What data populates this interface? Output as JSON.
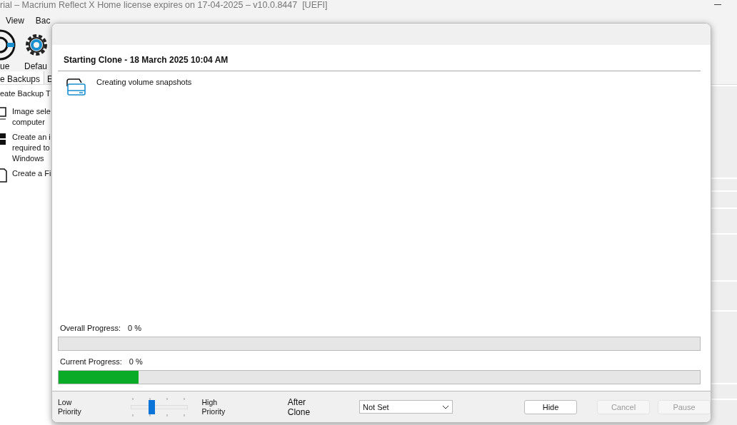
{
  "window": {
    "title": "rial – Macrium Reflect X Home license expires on 17-04-2025 – v10.0.8447  [UEFI]"
  },
  "menu": [
    "View",
    "Bac"
  ],
  "toolbar": [
    {
      "kind": "lifebuoy",
      "label": "ue"
    },
    {
      "kind": "gear",
      "label": "Defau"
    }
  ],
  "tabs": [
    {
      "label": "e Backups",
      "selected": true
    },
    {
      "label": "E",
      "selected": false
    }
  ],
  "tasks": {
    "heading": "eate Backup T",
    "items": [
      {
        "kind": "monitor",
        "lines": [
          "Image sele",
          "computer"
        ]
      },
      {
        "kind": "windows",
        "lines": [
          "Create an i",
          "required to",
          "Windows"
        ]
      },
      {
        "kind": "file",
        "lines": [
          "Create a Fi"
        ]
      }
    ]
  },
  "dialog": {
    "title": "Starting Clone - 18 March 2025 10:04 AM",
    "log": [
      {
        "text": "Creating volume snapshots"
      }
    ],
    "progress": [
      {
        "label": "Overall Progress:",
        "reading": "0 %",
        "level": 0
      },
      {
        "label": "Current Progress:",
        "reading": "0 %",
        "level": 0.125
      }
    ],
    "priority": {
      "low": "Low Priority",
      "high": "High Priority",
      "level": 0.35
    },
    "after_clone": {
      "label": "After Clone",
      "value": "Not Set"
    },
    "buttons": [
      {
        "label": "Hide",
        "disabled": false
      },
      {
        "label": "Cancel",
        "disabled": true
      },
      {
        "label": "Pause",
        "disabled": true
      }
    ]
  }
}
